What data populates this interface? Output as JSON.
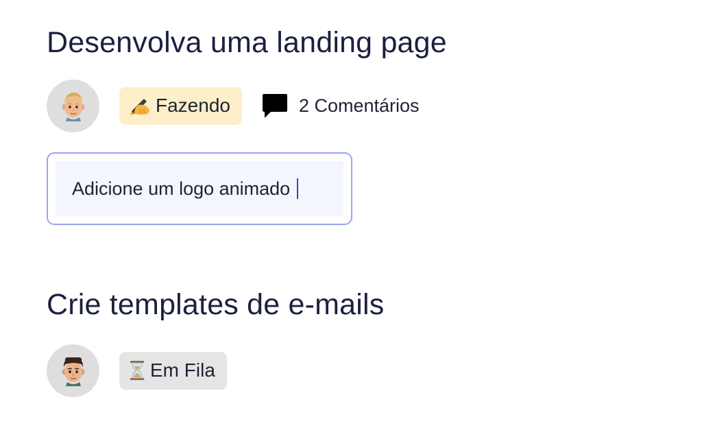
{
  "tasks": [
    {
      "title": "Desenvolva uma landing page",
      "avatar_icon": "blond-man-avatar-icon",
      "status": {
        "emoji": "writing-hand-icon",
        "label": "Fazendo",
        "color": "#fdefc9"
      },
      "comments": {
        "icon": "comment-bubble-icon",
        "label": "2 Comentários"
      },
      "subtask_input": {
        "value": "Adicione um logo animado"
      }
    },
    {
      "title": "Crie templates de e-mails",
      "avatar_icon": "dark-haired-man-avatar-icon",
      "status": {
        "emoji": "hourglass-icon",
        "label": "Em Fila",
        "color": "#e5e5e5"
      }
    }
  ],
  "colors": {
    "title_text": "#1b2040",
    "input_border_focus": "#9aa4f5",
    "input_background": "#f3f6fd",
    "caret": "#3545c7"
  }
}
